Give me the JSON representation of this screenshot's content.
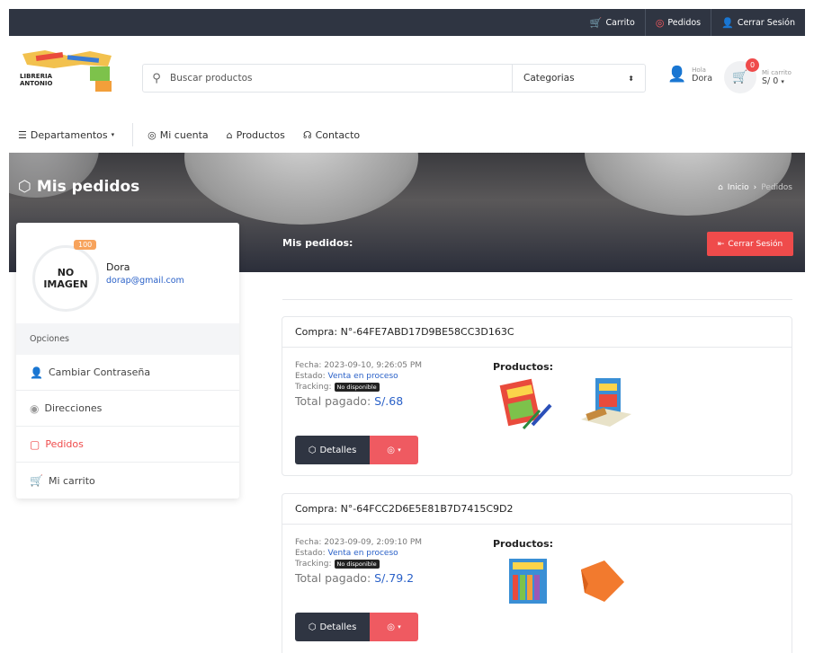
{
  "topbar": {
    "links": [
      {
        "label": "Carrito",
        "icon": "cart-icon"
      },
      {
        "label": "Pedidos",
        "icon": "orders-icon"
      },
      {
        "label": "Cerrar Sesión",
        "icon": "user-icon"
      }
    ]
  },
  "header": {
    "logo_text_1": "LIBRERIA",
    "logo_text_2": "ANTONIO",
    "search_placeholder": "Buscar productos",
    "category_select": "Categorias",
    "user_greeting": "Hola",
    "user_name": "Dora",
    "cart_label": "Mi carrito",
    "cart_total": "S/ 0",
    "cart_count": "0"
  },
  "nav": {
    "departments": "Departamentos",
    "items": [
      "Mi cuenta",
      "Productos",
      "Contacto"
    ]
  },
  "hero": {
    "title": "Mis pedidos",
    "breadcrumb_home": "Inicio",
    "breadcrumb_current": "Pedidos"
  },
  "profile": {
    "points": "100",
    "avatar_line1": "NO",
    "avatar_line2": "IMAGEN",
    "name": "Dora",
    "email": "dorap@gmail.com"
  },
  "sidebar": {
    "heading": "Opciones",
    "options": [
      "Cambiar Contraseña",
      "Direcciones",
      "Pedidos",
      "Mi carrito"
    ]
  },
  "main": {
    "title": "Mis pedidos:",
    "logout_button": "Cerrar Sesión"
  },
  "orders": [
    {
      "code": "Compra: N°-64FE7ABD17D9BE58CC3D163C",
      "fecha_label": "Fecha:",
      "fecha": "2023-09-10, 9:26:05 PM",
      "estado_label": "Estado:",
      "estado": "Venta en proceso",
      "tracking_label": "Tracking:",
      "tracking": "No disponible",
      "total_label": "Total pagado:",
      "total": "S/.68",
      "products_label": "Productos:",
      "details_button": "Detalles"
    },
    {
      "code": "Compra: N°-64FCC2D6E5E81B7D7415C9D2",
      "fecha_label": "Fecha:",
      "fecha": "2023-09-09, 2:09:10 PM",
      "estado_label": "Estado:",
      "estado": "Venta en proceso",
      "tracking_label": "Tracking:",
      "tracking": "No disponible",
      "total_label": "Total pagado:",
      "total": "S/.79.2",
      "products_label": "Productos:",
      "details_button": "Detalles"
    }
  ],
  "colors": {
    "topbar": "#2f3542",
    "accent_red": "#ef4b4b",
    "link_blue": "#2a61c8"
  }
}
